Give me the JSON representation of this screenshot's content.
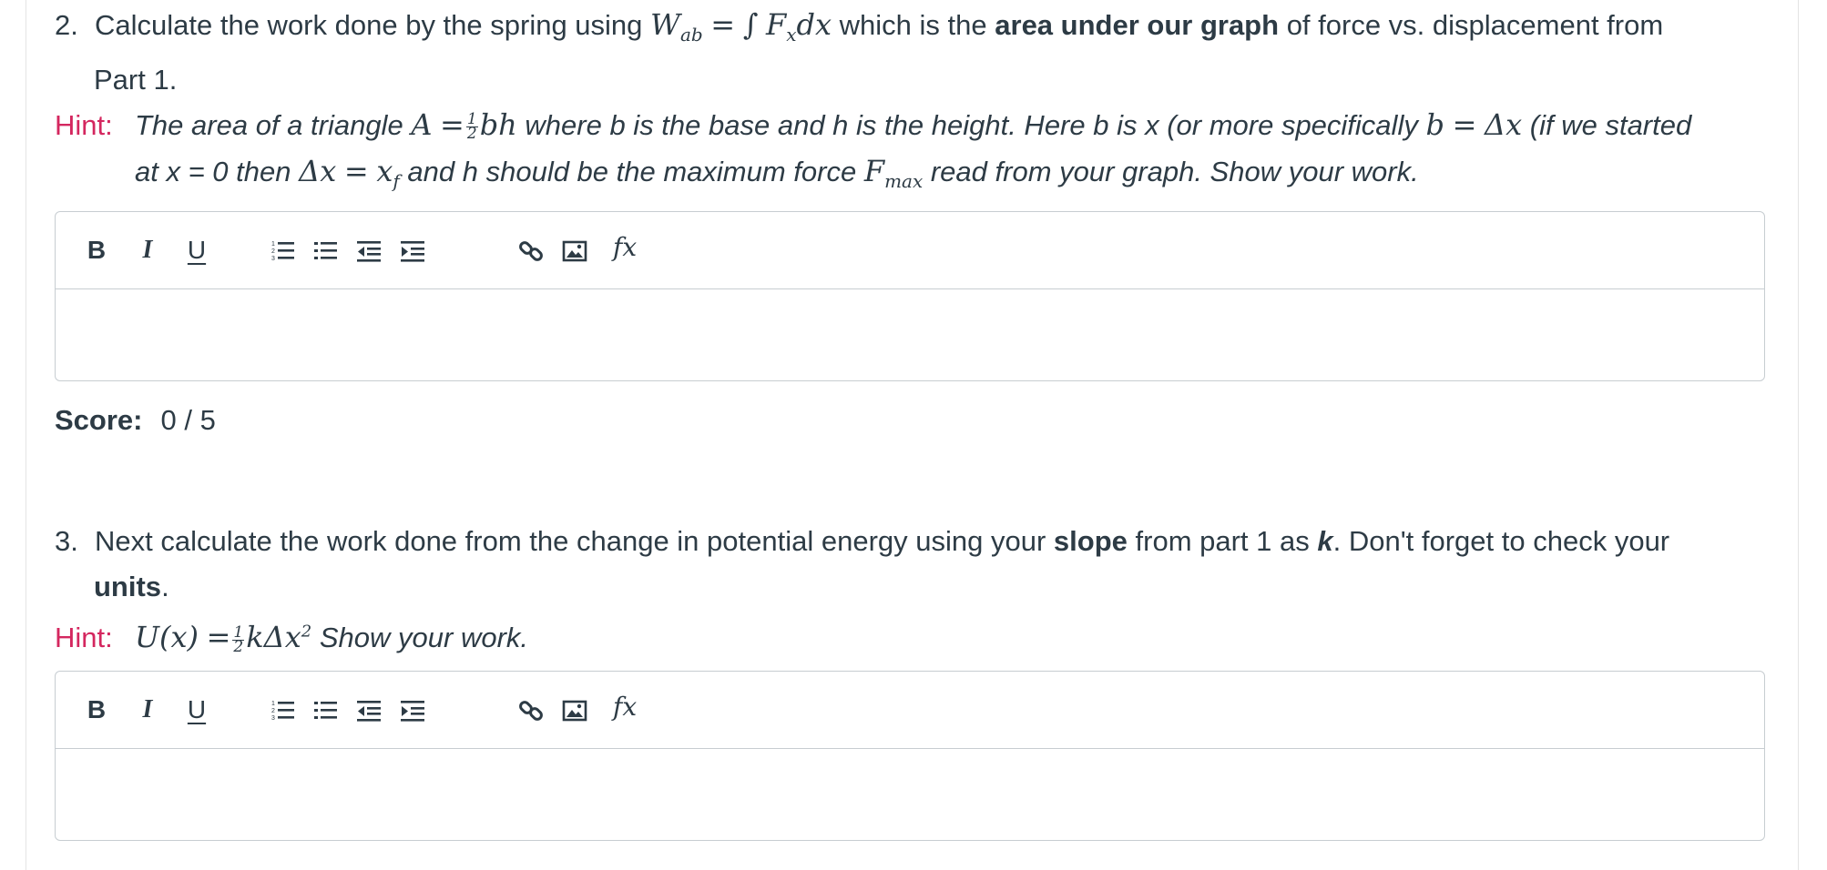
{
  "q2": {
    "number": "2.",
    "text_1": "Calculate the work done by the spring using",
    "math_W": "W",
    "math_W_sub": "ab",
    "math_eq": "=",
    "math_integral": "∫",
    "math_F": "F",
    "math_F_sub": "x",
    "math_dx": "dx",
    "text_2": "which is the",
    "text_bold": "area under our graph",
    "text_3": "of force vs. displacement from",
    "text_4": "Part 1.",
    "hint_label": "Hint:",
    "hint_1": "The area of a triangle",
    "hint_A": "A",
    "hint_eq": "=",
    "hint_frac_num": "1",
    "hint_frac_den": "2",
    "hint_bh": "bh",
    "hint_2": "where b is the base and h is the height. Here b is x (or more specifically",
    "hint_b": "b",
    "hint_eq2": "=",
    "hint_dx": "Δx",
    "hint_3": "(if we started",
    "hint_4": "at x = 0 then",
    "hint_dx2": "Δx",
    "hint_eq3": "=",
    "hint_xf": "x",
    "hint_xf_sub": "f",
    "hint_5": "and h should be the maximum force",
    "hint_F": "F",
    "hint_F_sub": "max",
    "hint_6": "read from your graph. Show your work.",
    "score_label": "Score:",
    "score_value": "0 / 5"
  },
  "q3": {
    "number": "3.",
    "text_1": "Next calculate the work done from the change in potential energy using your",
    "text_bold": "slope",
    "text_2": "from part 1 as",
    "text_k": "k",
    "text_3": ". Don't forget to check your",
    "text_units": "units",
    "text_4": ".",
    "hint_label": "Hint:",
    "hint_U": "U(x)",
    "hint_eq": "=",
    "hint_frac_num": "1",
    "hint_frac_den": "2",
    "hint_k": "kΔx",
    "hint_sup": "2",
    "hint_1": "Show your work."
  },
  "toolbar": {
    "bold": "B",
    "italic": "I",
    "underline": "U",
    "fx": "fx"
  },
  "icons": [
    "ordered-list-icon",
    "unordered-list-icon",
    "outdent-icon",
    "indent-icon",
    "link-icon",
    "image-icon",
    "formula-icon"
  ],
  "colors": {
    "hint": "#d4275f",
    "text": "#2d3b45",
    "border": "#c7cdd1"
  }
}
